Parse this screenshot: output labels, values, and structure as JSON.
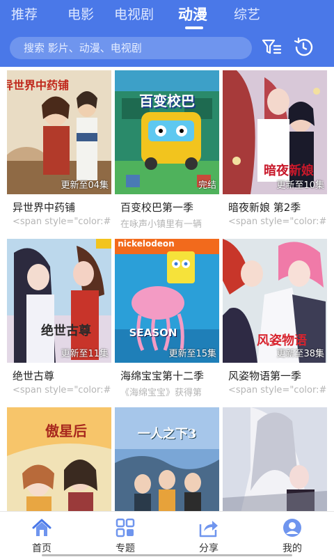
{
  "top_tabs": [
    {
      "label": "推荐"
    },
    {
      "label": "电影"
    },
    {
      "label": "电视剧"
    },
    {
      "label": "动漫"
    },
    {
      "label": "综艺"
    }
  ],
  "active_tab": "动漫",
  "search": {
    "placeholder": "搜索 影片、动漫、电视剧"
  },
  "header_icons": [
    "filter-icon",
    "history-icon"
  ],
  "colors": {
    "brand": "#4a78e8",
    "search_bg": "#6f95ee",
    "nav_icon": "#6f95ee"
  },
  "items": [
    {
      "title": "异世界中药铺",
      "status": "更新至04集",
      "desc": "<span style=\"color:#",
      "cover_text": "异世界中药铺"
    },
    {
      "title": "百变校巴第一季",
      "status": "完结",
      "desc": "在咏声小镇里有一辆",
      "cover_text": "百变校巴"
    },
    {
      "title": "暗夜新娘 第2季",
      "status": "更新至10集",
      "desc": "<span style=\"color:#",
      "cover_text": "暗夜新娘"
    },
    {
      "title": "绝世古尊",
      "status": "更新至11集",
      "desc": "<span style=\"color:#",
      "cover_text": "绝世古尊"
    },
    {
      "title": "海绵宝宝第十二季",
      "status": "更新至15集",
      "desc": "《海绵宝宝》获得第",
      "cover_text": "nickelodeon",
      "cover_text2": "SEASON"
    },
    {
      "title": "风姿物语第一季",
      "status": "更新至38集",
      "desc": "<span style=\"color:#",
      "cover_text": "风姿物语"
    },
    {
      "title": "",
      "status": "",
      "desc": "",
      "cover_text": "傲星后"
    },
    {
      "title": "",
      "status": "",
      "desc": "",
      "cover_text": "一人之下3"
    },
    {
      "title": "",
      "status": "",
      "desc": "",
      "cover_text": ""
    }
  ],
  "bottom_nav": [
    {
      "label": "首页",
      "icon": "home-icon",
      "active": true
    },
    {
      "label": "专题",
      "icon": "grid-icon"
    },
    {
      "label": "分享",
      "icon": "share-icon"
    },
    {
      "label": "我的",
      "icon": "profile-icon"
    }
  ]
}
